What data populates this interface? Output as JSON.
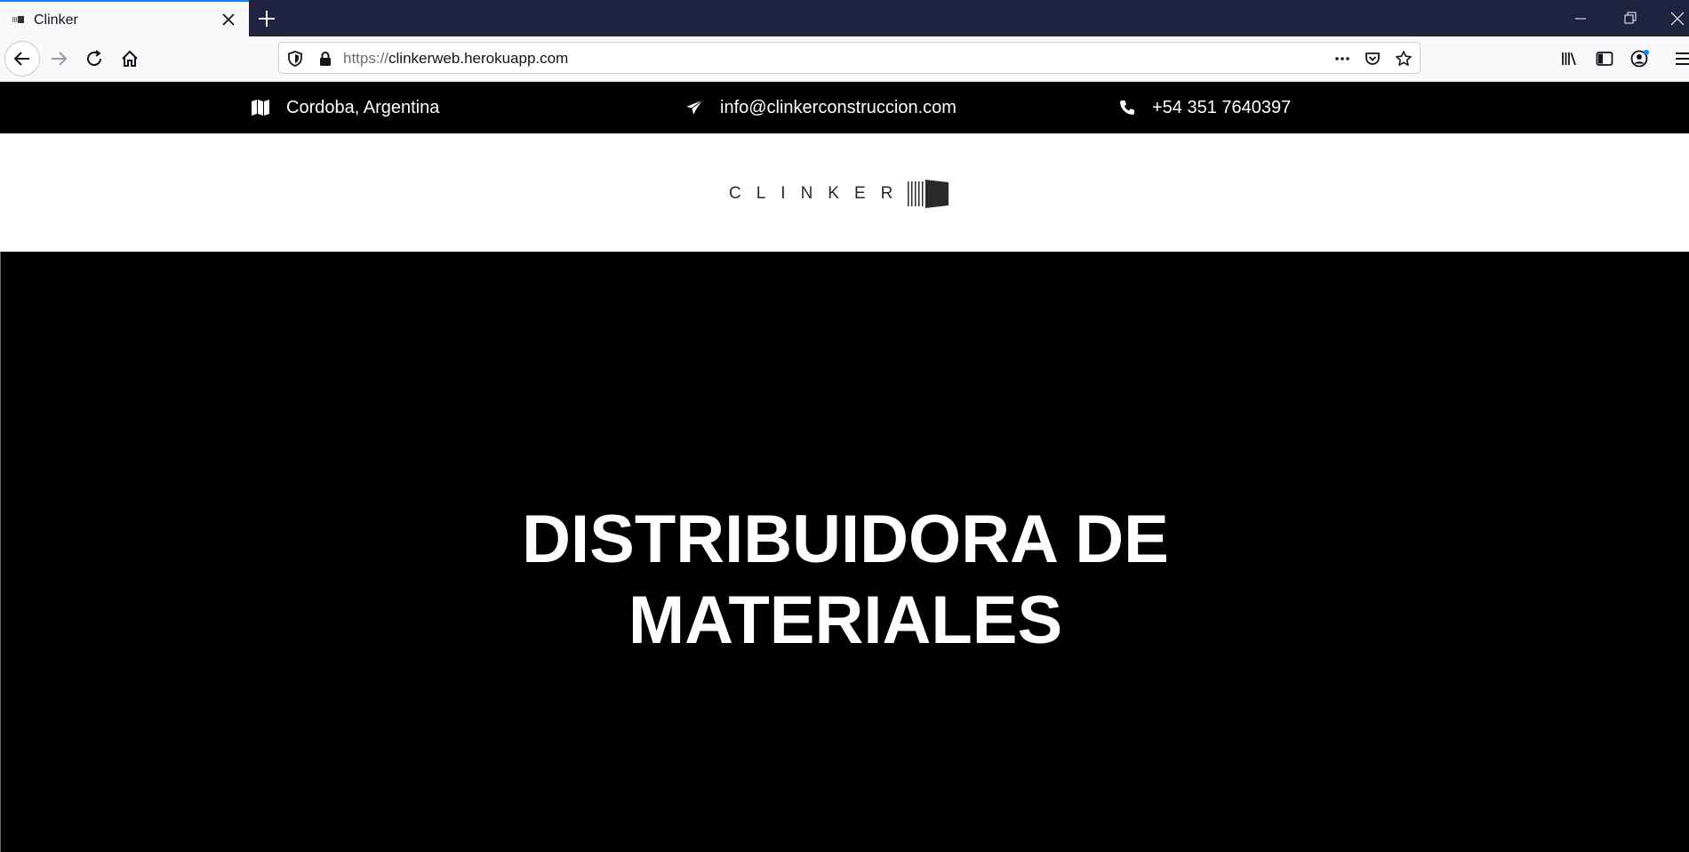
{
  "browser": {
    "tab": {
      "title": "Clinker"
    },
    "url": {
      "scheme": "https://",
      "host": "clinkerweb.herokuapp.com"
    },
    "icons": [
      "back-arrow-icon",
      "forward-arrow-icon",
      "reload-icon",
      "home-icon",
      "shield-icon",
      "lock-icon",
      "more-dots-icon",
      "pocket-icon",
      "star-icon",
      "library-icon",
      "sidebar-icon",
      "account-icon",
      "menu-icon",
      "minimize-icon",
      "restore-icon",
      "close-icon"
    ]
  },
  "topbar": {
    "location": "Cordoba, Argentina",
    "email": "info@clinkerconstruccion.com",
    "phone": "+54 351 7640397"
  },
  "logo": {
    "text": "CLINKER"
  },
  "hero": {
    "title_line1": "DISTRIBUIDORA DE",
    "title_line2": "MATERIALES"
  },
  "colors": {
    "tabstrip": "#202340",
    "accent": "#0a84ff",
    "page_bg": "#000000",
    "header_bg": "#ffffff"
  }
}
